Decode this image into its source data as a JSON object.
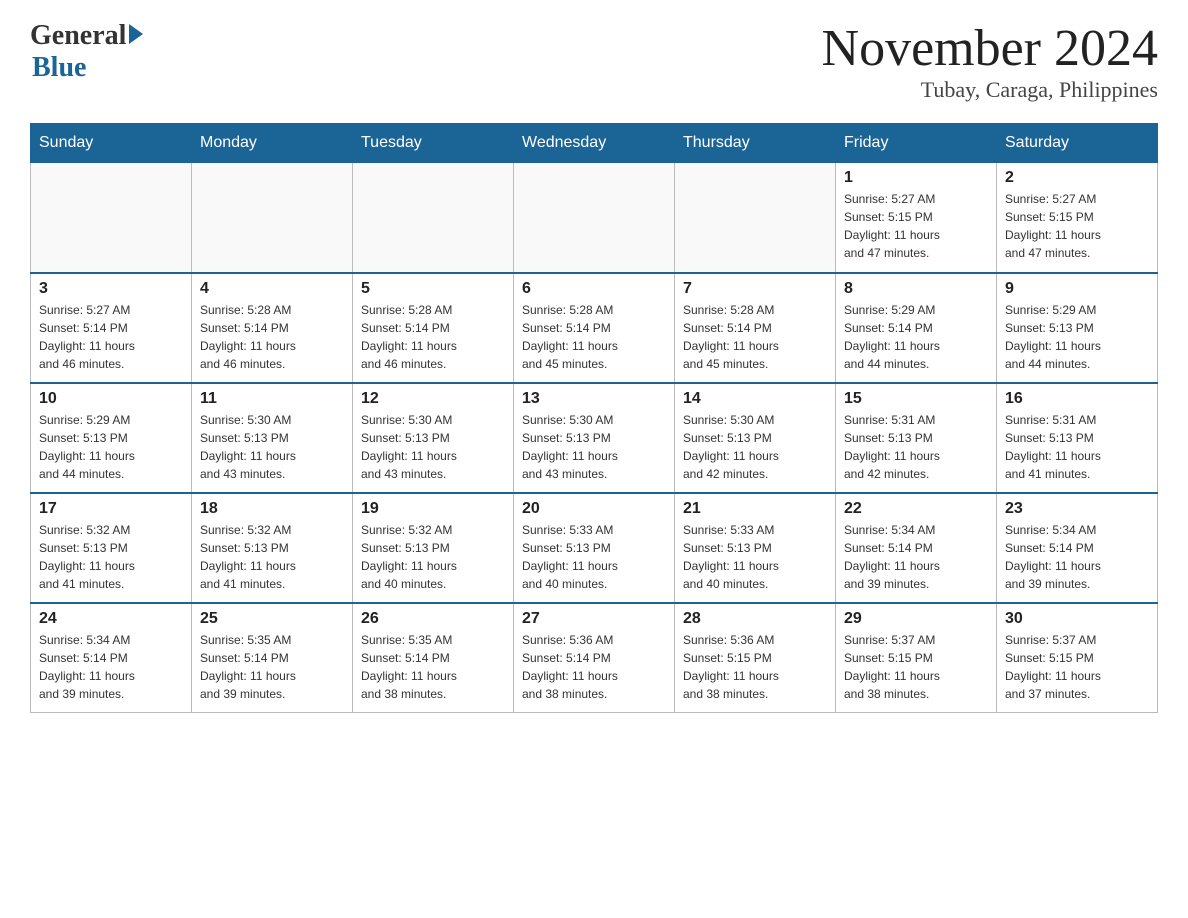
{
  "logo": {
    "general": "General",
    "blue": "Blue"
  },
  "title": {
    "month_year": "November 2024",
    "location": "Tubay, Caraga, Philippines"
  },
  "days_of_week": [
    "Sunday",
    "Monday",
    "Tuesday",
    "Wednesday",
    "Thursday",
    "Friday",
    "Saturday"
  ],
  "weeks": [
    [
      {
        "day": "",
        "info": ""
      },
      {
        "day": "",
        "info": ""
      },
      {
        "day": "",
        "info": ""
      },
      {
        "day": "",
        "info": ""
      },
      {
        "day": "",
        "info": ""
      },
      {
        "day": "1",
        "info": "Sunrise: 5:27 AM\nSunset: 5:15 PM\nDaylight: 11 hours\nand 47 minutes."
      },
      {
        "day": "2",
        "info": "Sunrise: 5:27 AM\nSunset: 5:15 PM\nDaylight: 11 hours\nand 47 minutes."
      }
    ],
    [
      {
        "day": "3",
        "info": "Sunrise: 5:27 AM\nSunset: 5:14 PM\nDaylight: 11 hours\nand 46 minutes."
      },
      {
        "day": "4",
        "info": "Sunrise: 5:28 AM\nSunset: 5:14 PM\nDaylight: 11 hours\nand 46 minutes."
      },
      {
        "day": "5",
        "info": "Sunrise: 5:28 AM\nSunset: 5:14 PM\nDaylight: 11 hours\nand 46 minutes."
      },
      {
        "day": "6",
        "info": "Sunrise: 5:28 AM\nSunset: 5:14 PM\nDaylight: 11 hours\nand 45 minutes."
      },
      {
        "day": "7",
        "info": "Sunrise: 5:28 AM\nSunset: 5:14 PM\nDaylight: 11 hours\nand 45 minutes."
      },
      {
        "day": "8",
        "info": "Sunrise: 5:29 AM\nSunset: 5:14 PM\nDaylight: 11 hours\nand 44 minutes."
      },
      {
        "day": "9",
        "info": "Sunrise: 5:29 AM\nSunset: 5:13 PM\nDaylight: 11 hours\nand 44 minutes."
      }
    ],
    [
      {
        "day": "10",
        "info": "Sunrise: 5:29 AM\nSunset: 5:13 PM\nDaylight: 11 hours\nand 44 minutes."
      },
      {
        "day": "11",
        "info": "Sunrise: 5:30 AM\nSunset: 5:13 PM\nDaylight: 11 hours\nand 43 minutes."
      },
      {
        "day": "12",
        "info": "Sunrise: 5:30 AM\nSunset: 5:13 PM\nDaylight: 11 hours\nand 43 minutes."
      },
      {
        "day": "13",
        "info": "Sunrise: 5:30 AM\nSunset: 5:13 PM\nDaylight: 11 hours\nand 43 minutes."
      },
      {
        "day": "14",
        "info": "Sunrise: 5:30 AM\nSunset: 5:13 PM\nDaylight: 11 hours\nand 42 minutes."
      },
      {
        "day": "15",
        "info": "Sunrise: 5:31 AM\nSunset: 5:13 PM\nDaylight: 11 hours\nand 42 minutes."
      },
      {
        "day": "16",
        "info": "Sunrise: 5:31 AM\nSunset: 5:13 PM\nDaylight: 11 hours\nand 41 minutes."
      }
    ],
    [
      {
        "day": "17",
        "info": "Sunrise: 5:32 AM\nSunset: 5:13 PM\nDaylight: 11 hours\nand 41 minutes."
      },
      {
        "day": "18",
        "info": "Sunrise: 5:32 AM\nSunset: 5:13 PM\nDaylight: 11 hours\nand 41 minutes."
      },
      {
        "day": "19",
        "info": "Sunrise: 5:32 AM\nSunset: 5:13 PM\nDaylight: 11 hours\nand 40 minutes."
      },
      {
        "day": "20",
        "info": "Sunrise: 5:33 AM\nSunset: 5:13 PM\nDaylight: 11 hours\nand 40 minutes."
      },
      {
        "day": "21",
        "info": "Sunrise: 5:33 AM\nSunset: 5:13 PM\nDaylight: 11 hours\nand 40 minutes."
      },
      {
        "day": "22",
        "info": "Sunrise: 5:34 AM\nSunset: 5:14 PM\nDaylight: 11 hours\nand 39 minutes."
      },
      {
        "day": "23",
        "info": "Sunrise: 5:34 AM\nSunset: 5:14 PM\nDaylight: 11 hours\nand 39 minutes."
      }
    ],
    [
      {
        "day": "24",
        "info": "Sunrise: 5:34 AM\nSunset: 5:14 PM\nDaylight: 11 hours\nand 39 minutes."
      },
      {
        "day": "25",
        "info": "Sunrise: 5:35 AM\nSunset: 5:14 PM\nDaylight: 11 hours\nand 39 minutes."
      },
      {
        "day": "26",
        "info": "Sunrise: 5:35 AM\nSunset: 5:14 PM\nDaylight: 11 hours\nand 38 minutes."
      },
      {
        "day": "27",
        "info": "Sunrise: 5:36 AM\nSunset: 5:14 PM\nDaylight: 11 hours\nand 38 minutes."
      },
      {
        "day": "28",
        "info": "Sunrise: 5:36 AM\nSunset: 5:15 PM\nDaylight: 11 hours\nand 38 minutes."
      },
      {
        "day": "29",
        "info": "Sunrise: 5:37 AM\nSunset: 5:15 PM\nDaylight: 11 hours\nand 38 minutes."
      },
      {
        "day": "30",
        "info": "Sunrise: 5:37 AM\nSunset: 5:15 PM\nDaylight: 11 hours\nand 37 minutes."
      }
    ]
  ]
}
